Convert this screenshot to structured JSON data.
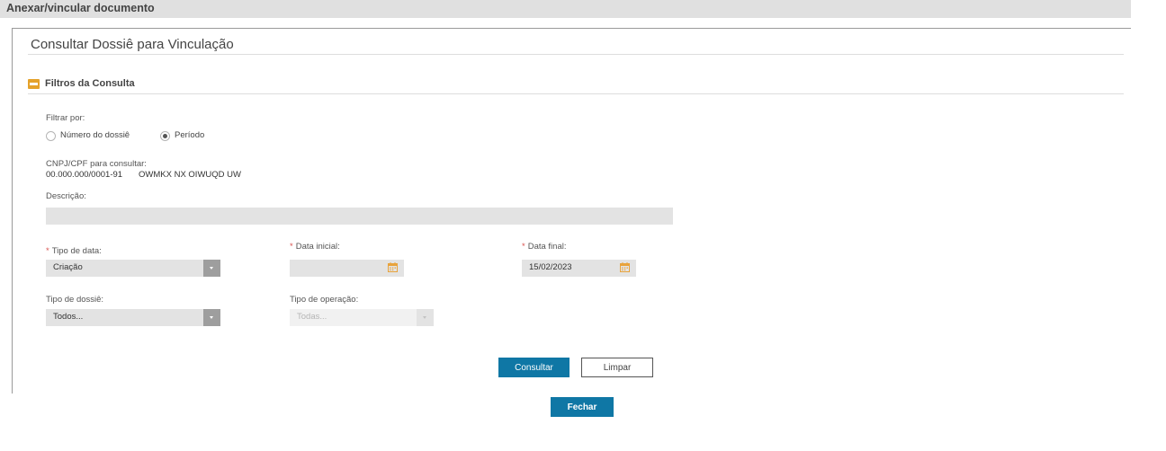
{
  "window": {
    "title": "Anexar/vincular documento"
  },
  "panel": {
    "title": "Consultar Dossiê para Vinculação"
  },
  "filters": {
    "section_title": "Filtros da Consulta",
    "filter_by_label": "Filtrar por:",
    "options": [
      {
        "label": "Número do dossiê",
        "checked": false
      },
      {
        "label": "Período",
        "checked": true
      }
    ],
    "cnpj_label": "CNPJ/CPF para consultar:",
    "cnpj_value": "00.000.000/0001-91",
    "company_name": "OWMKX NX OIWUQD UW",
    "description_label": "Descrição:",
    "description_value": "",
    "date_type": {
      "label": "Tipo de data:",
      "required_mark": "*",
      "value": "Criação"
    },
    "start_date": {
      "label": "Data inicial:",
      "required_mark": "*",
      "value": ""
    },
    "end_date": {
      "label": "Data final:",
      "required_mark": "*",
      "value": "15/02/2023"
    },
    "dossier_type": {
      "label": "Tipo de dossiê:",
      "value": "Todos..."
    },
    "operation_type": {
      "label": "Tipo de operação:",
      "value": "Todas...",
      "disabled": true
    }
  },
  "actions": {
    "search_label": "Consultar",
    "clear_label": "Limpar",
    "close_label": "Fechar"
  },
  "colors": {
    "primary": "#0f77a5",
    "toggle_accent": "#e5a22b",
    "required": "#d9534f",
    "calendar_icon": "#e8a33c"
  }
}
